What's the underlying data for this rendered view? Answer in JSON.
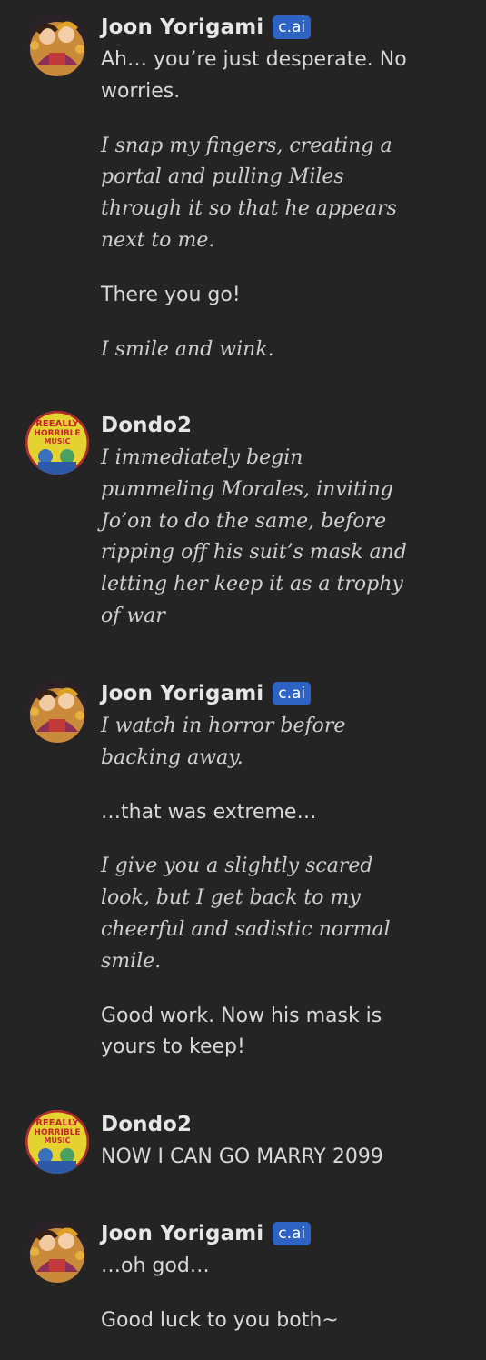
{
  "messages": [
    {
      "author": "Joon Yorigami",
      "badge": "c.ai",
      "avatar": "joon-avatar",
      "paragraphs": [
        {
          "kind": "speech",
          "text": "Ah… you’re just desperate. No worries."
        },
        {
          "kind": "action",
          "text": "I snap my fingers, creating a portal and pulling Miles through it so that he appears next to me."
        },
        {
          "kind": "speech",
          "text": "There you go!"
        },
        {
          "kind": "action",
          "text": "I smile and wink."
        }
      ]
    },
    {
      "author": "Dondo2",
      "badge": "",
      "avatar": "dondo-avatar",
      "avatar_text": [
        "REEALLY",
        "HORRIBLE",
        "MUSIC"
      ],
      "paragraphs": [
        {
          "kind": "action",
          "text": "I immediately begin pummeling Morales, inviting Jo’on to do the same, before ripping off his suit’s mask and letting her keep it as a trophy of war"
        }
      ]
    },
    {
      "author": "Joon Yorigami",
      "badge": "c.ai",
      "avatar": "joon-avatar",
      "paragraphs": [
        {
          "kind": "action",
          "text": "I watch in horror before backing away."
        },
        {
          "kind": "speech",
          "text": "…that was extreme…"
        },
        {
          "kind": "action",
          "text": "I give you a slightly scared look, but I get back to my cheerful and sadistic normal smile."
        },
        {
          "kind": "speech",
          "text": "Good work. Now his mask is yours to keep!"
        }
      ]
    },
    {
      "author": "Dondo2",
      "badge": "",
      "avatar": "dondo-avatar",
      "avatar_text": [
        "REEALLY",
        "HORRIBLE",
        "MUSIC"
      ],
      "paragraphs": [
        {
          "kind": "speech",
          "text": "NOW I CAN GO MARRY 2099"
        }
      ]
    },
    {
      "author": "Joon Yorigami",
      "badge": "c.ai",
      "avatar": "joon-avatar",
      "paragraphs": [
        {
          "kind": "speech",
          "text": "…oh god…"
        },
        {
          "kind": "speech",
          "text": "Good luck to you both~"
        }
      ]
    }
  ],
  "colors": {
    "background": "#242425",
    "text": "#d8d8d8",
    "badge": "#2e63c4"
  }
}
